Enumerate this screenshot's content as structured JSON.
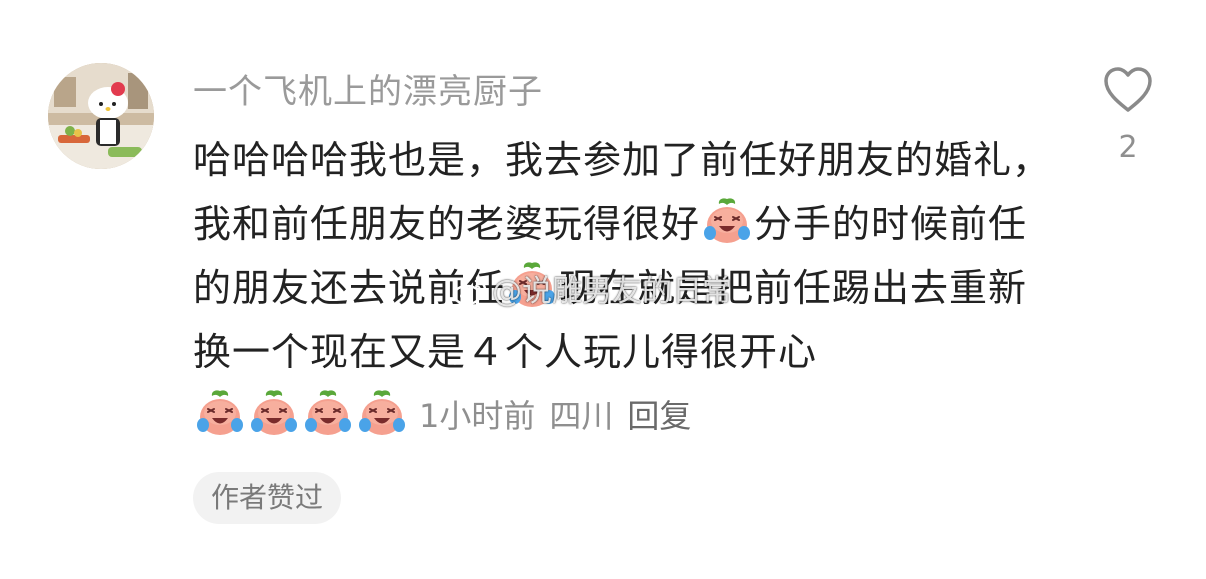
{
  "comment": {
    "username": "一个飞机上的漂亮厨子",
    "text_segments": [
      "哈哈哈哈我也是，我去参加了前任好朋友的婚礼，我和前任朋友的老婆玩得很好",
      "分手的时候前任的朋友还去说前任",
      "现在就是把前任踢出去重新换一个现在又是４个人玩儿得很开心"
    ],
    "emoji_name": "crying-laughing-peach",
    "time": "1小时前",
    "location": "四川",
    "reply_label": "回复",
    "author_badge": "作者赞过",
    "like_count": "2"
  },
  "watermark": {
    "text": "@说雕男友的日常"
  },
  "colors": {
    "username": "#9a9a9a",
    "text": "#222222",
    "meta": "#8f8f8f",
    "badge_bg": "#f2f2f2"
  }
}
